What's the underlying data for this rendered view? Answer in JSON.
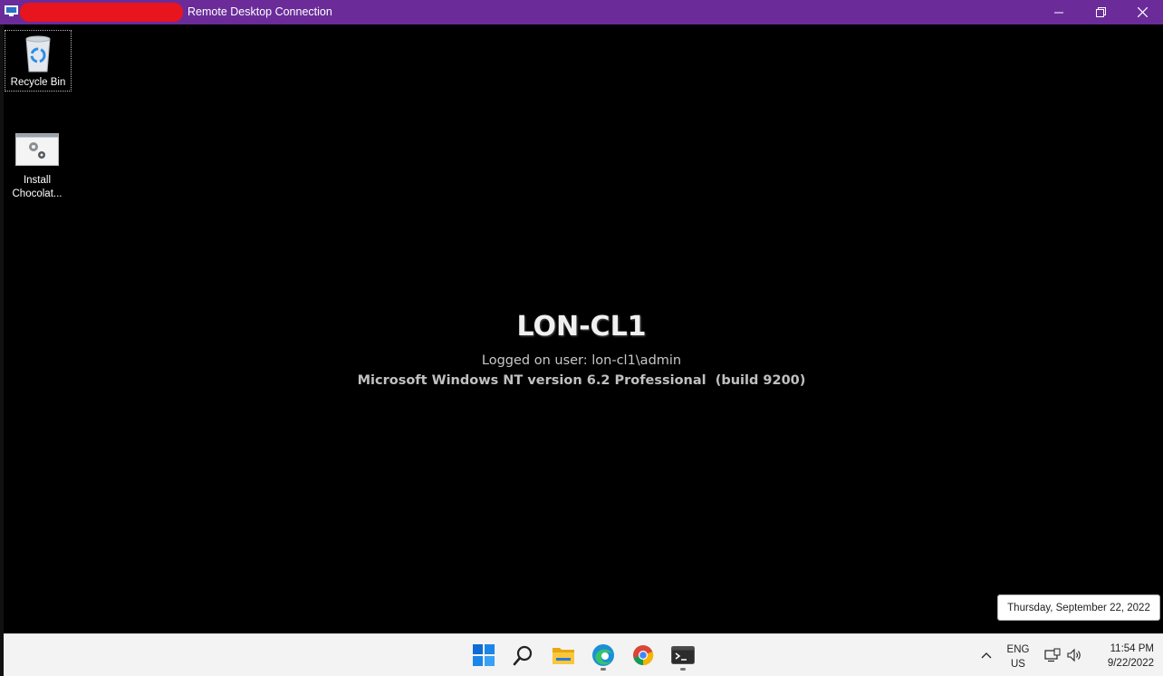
{
  "window": {
    "title": "Remote Desktop Connection",
    "titlebar_color": "#6b2c9a",
    "controls": [
      "minimize-icon",
      "restore-icon",
      "close-icon"
    ]
  },
  "desktop_icons": [
    {
      "label": "Recycle Bin",
      "icon": "recycle-bin-icon"
    },
    {
      "label": "Install Chocolat...",
      "label_line1": "Install",
      "label_line2": "Chocolat...",
      "icon": "settings-script-icon"
    }
  ],
  "bginfo": {
    "hostname": "LON-CL1",
    "logged_on": "Logged on user: lon-cl1\\admin",
    "os": "Microsoft Windows NT version 6.2 Professional  (build 9200)"
  },
  "tooltip": {
    "text": "Thursday, September 22, 2022"
  },
  "taskbar": {
    "apps": [
      "windows-start-icon",
      "search-icon",
      "file-explorer-icon",
      "edge-icon",
      "chrome-icon",
      "terminal-icon"
    ],
    "language": {
      "line1": "ENG",
      "line2": "US"
    },
    "clock": {
      "time": "11:54 PM",
      "date": "9/22/2022"
    }
  }
}
